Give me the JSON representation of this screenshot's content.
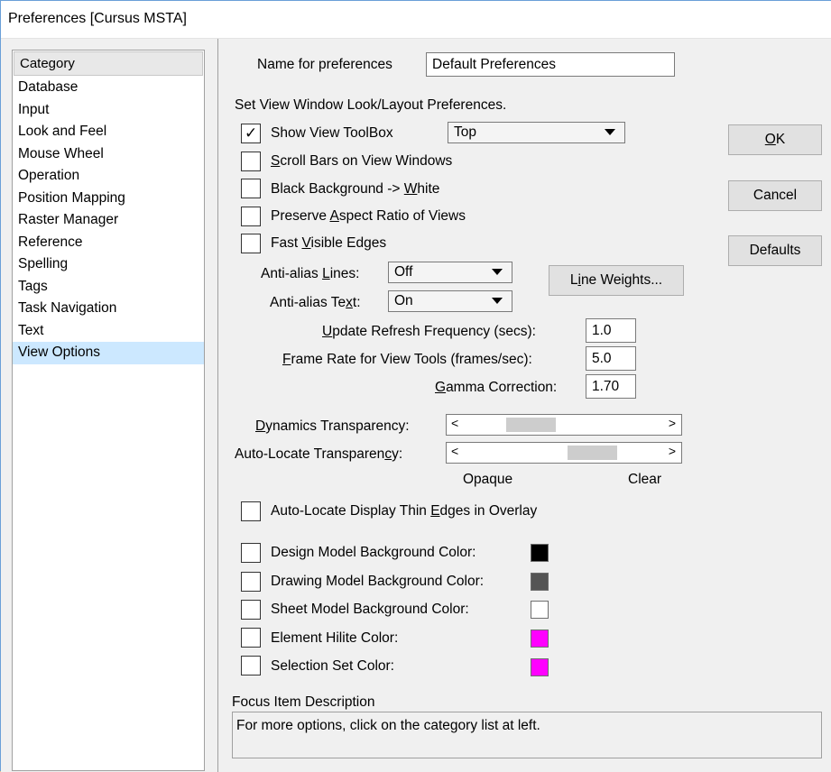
{
  "window": {
    "title": "Preferences [Cursus MSTA]"
  },
  "category": {
    "header": "Category",
    "items": [
      {
        "label": "Database",
        "selected": false
      },
      {
        "label": "Input",
        "selected": false
      },
      {
        "label": "Look and Feel",
        "selected": false
      },
      {
        "label": "Mouse Wheel",
        "selected": false
      },
      {
        "label": "Operation",
        "selected": false
      },
      {
        "label": "Position Mapping",
        "selected": false
      },
      {
        "label": "Raster Manager",
        "selected": false
      },
      {
        "label": "Reference",
        "selected": false
      },
      {
        "label": "Spelling",
        "selected": false
      },
      {
        "label": "Tags",
        "selected": false
      },
      {
        "label": "Task Navigation",
        "selected": false
      },
      {
        "label": "Text",
        "selected": false
      },
      {
        "label": "View Options",
        "selected": true
      }
    ]
  },
  "prefs_name": {
    "label": "Name for preferences",
    "value": "Default Preferences"
  },
  "section_heading": "Set View Window Look/Layout Preferences.",
  "checks": {
    "show_toolbox": {
      "pre": "Show View ToolBox",
      "acc": "",
      "post": "",
      "checked": true
    },
    "scroll_bars": {
      "pre": "",
      "acc": "S",
      "post": "croll Bars on View Windows",
      "checked": false
    },
    "black_bg": {
      "pre": "Black Background -> ",
      "acc": "W",
      "post": "hite",
      "checked": false
    },
    "aspect": {
      "pre": "Preserve ",
      "acc": "A",
      "post": "spect Ratio of Views",
      "checked": false
    },
    "fast_edges": {
      "pre": "Fast ",
      "acc": "V",
      "post": "isible Edges",
      "checked": false
    },
    "thin_edges": {
      "pre": "Auto-Locate Display Thin ",
      "acc": "E",
      "post": "dges in Overlay",
      "checked": false
    }
  },
  "toolbox_position": "Top",
  "antialias": {
    "lines_pre": "Anti-alias ",
    "lines_acc": "L",
    "lines_post": "ines:",
    "lines_value": "Off",
    "text_pre": "Anti-alias Te",
    "text_acc": "x",
    "text_post": "t:",
    "text_value": "On"
  },
  "line_weights": {
    "pre": "L",
    "acc": "i",
    "post": "ne Weights..."
  },
  "fields": {
    "refresh": {
      "acc": "U",
      "post": "pdate Refresh Frequency (secs):",
      "value": "1.0"
    },
    "frame_rate": {
      "acc": "F",
      "post": "rame Rate for View Tools (frames/sec):",
      "value": "5.0"
    },
    "gamma": {
      "acc": "G",
      "post": "amma Correction:",
      "value": "1.70"
    }
  },
  "transparency": {
    "dynamics": {
      "acc": "D",
      "post": "ynamics Transparency:"
    },
    "autolocate": {
      "pre": "Auto-Locate Transparen",
      "acc": "c",
      "post": "y:"
    },
    "left_arrow": "<",
    "right_arrow": ">",
    "opaque_label": "Opaque",
    "clear_label": "Clear"
  },
  "colors": [
    {
      "label": "Design Model Background Color:",
      "color": "#000000",
      "checked": false
    },
    {
      "label": "Drawing Model Background Color:",
      "color": "#555555",
      "checked": false
    },
    {
      "label": "Sheet Model Background Color:",
      "color": "#ffffff",
      "checked": false
    },
    {
      "label": "Element Hilite Color:",
      "color": "#ff00ff",
      "checked": false
    },
    {
      "label": "Selection Set Color:",
      "color": "#ff00ff",
      "checked": false
    }
  ],
  "buttons": {
    "ok_acc": "O",
    "ok_post": "K",
    "cancel": "Cancel",
    "defaults": "Defaults"
  },
  "focus": {
    "heading": "Focus Item Description",
    "text": "For more options, click on the category list at left."
  }
}
